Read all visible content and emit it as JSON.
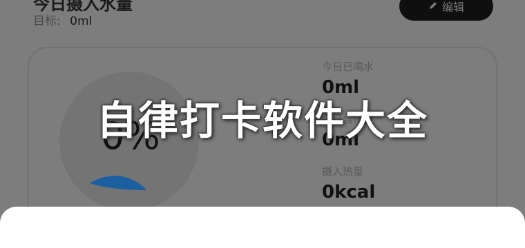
{
  "header": {
    "title": "今日摄入水量",
    "target_label": "目标:",
    "target_value": "0ml",
    "edit_label": "编辑",
    "edit_icon": "pencil-icon"
  },
  "card": {
    "percent_text": "0%",
    "progress": 0,
    "stats": [
      {
        "label": "今日已喝水",
        "value": "0ml"
      },
      {
        "label": "今日含水量",
        "value": "0ml"
      },
      {
        "label": "摄入热量",
        "value": "0kcal"
      }
    ]
  },
  "overlay": {
    "banner": "自律打卡软件大全"
  },
  "colors": {
    "wave": "#1a5fa0",
    "button_bg": "#0f0f0f",
    "sheet": "#ffffff"
  }
}
